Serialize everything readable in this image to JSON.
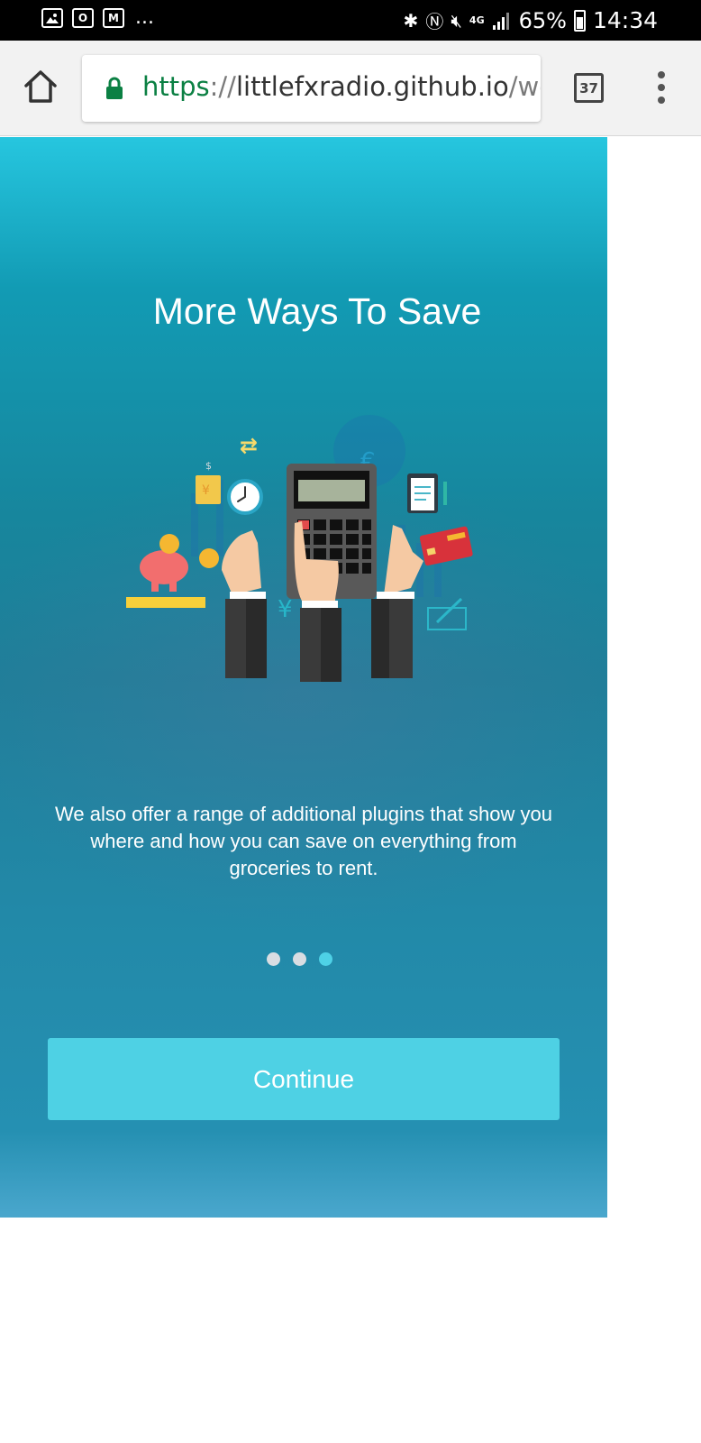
{
  "status_bar": {
    "left_icons": [
      "gallery-icon",
      "outlook-icon",
      "gmail-icon"
    ],
    "more": "...",
    "right_icons": [
      "bluetooth-icon",
      "nfc-icon",
      "mute-icon",
      "signal-icon",
      "battery-icon"
    ],
    "network": "4G",
    "battery": "65%",
    "time": "14:34"
  },
  "browser": {
    "url_protocol": "https",
    "url_separator": "://",
    "url_host": "littlefxradio.github.io",
    "url_rest": "/we",
    "tab_count": "37",
    "icons": [
      "home-icon",
      "lock-icon",
      "tabs-icon",
      "more-vert-icon"
    ]
  },
  "onboarding": {
    "title": "More Ways To Save",
    "description": "We also offer a range of additional plugins that show you where and how you can save on everything from groceries to rent.",
    "pagination": {
      "total": 3,
      "active": 3
    },
    "continue_label": "Continue",
    "illustration_glyphs": {
      "dollar": "$",
      "euro": "€",
      "yen": "¥",
      "yuan": "¥",
      "swap": "⇄"
    }
  },
  "colors": {
    "status_bar": "#000000",
    "toolbar": "#f2f2f2",
    "url_secure": "#0b8043",
    "hero_top": "#26c6df",
    "hero_bottom": "#2590b2",
    "button": "#4ed1e4",
    "dot_active": "#4ed1e6",
    "dot_inactive": "#d9dde2"
  }
}
